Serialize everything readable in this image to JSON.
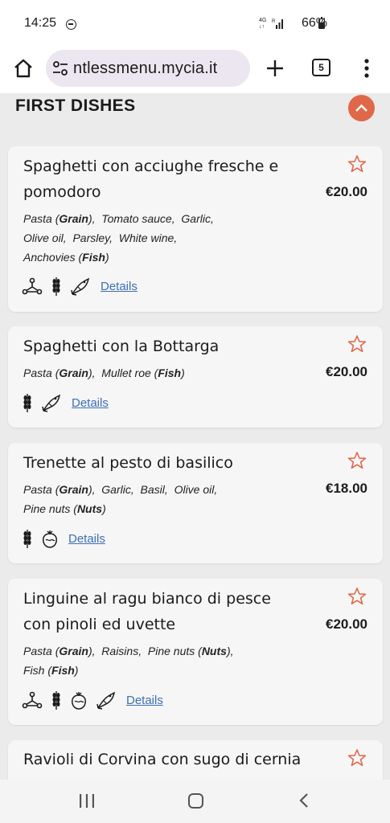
{
  "status_bar": {
    "time": "14:25",
    "network": "4G",
    "battery": "66%"
  },
  "browser": {
    "url": "ntlessmenu.mycia.it",
    "tab_count": "5"
  },
  "section": {
    "title": "FIRST DISHES"
  },
  "dishes": [
    {
      "name": "Spaghetti con acciughe fresche e pomodoro",
      "price": "€20.00",
      "ingredients": [
        {
          "name": "Pasta",
          "allergen": "Grain"
        },
        {
          "name": "Tomato sauce"
        },
        {
          "name": "Garlic"
        },
        {
          "name": "Olive oil"
        },
        {
          "name": "Parsley"
        },
        {
          "name": "White wine"
        },
        {
          "name": "Anchovies",
          "allergen": "Fish"
        }
      ],
      "icons": [
        "molecule-icon",
        "wheat-icon",
        "fish-icon"
      ],
      "details_label": "Details"
    },
    {
      "name": "Spaghetti con la Bottarga",
      "price": "€20.00",
      "ingredients": [
        {
          "name": "Pasta",
          "allergen": "Grain"
        },
        {
          "name": "Mullet roe",
          "allergen": "Fish"
        }
      ],
      "icons": [
        "wheat-icon",
        "fish-icon"
      ],
      "details_label": "Details"
    },
    {
      "name": "Trenette al pesto di basilico",
      "price": "€18.00",
      "ingredients": [
        {
          "name": "Pasta",
          "allergen": "Grain"
        },
        {
          "name": "Garlic"
        },
        {
          "name": "Basil"
        },
        {
          "name": "Olive oil"
        },
        {
          "name": "Pine nuts",
          "allergen": "Nuts"
        }
      ],
      "icons": [
        "wheat-icon",
        "nut-icon"
      ],
      "details_label": "Details"
    },
    {
      "name": "Linguine al ragu bianco di pesce con pinoli ed uvette",
      "price": "€20.00",
      "ingredients": [
        {
          "name": "Pasta",
          "allergen": "Grain"
        },
        {
          "name": "Raisins"
        },
        {
          "name": "Pine nuts",
          "allergen": "Nuts"
        },
        {
          "name": "Fish",
          "allergen": "Fish"
        }
      ],
      "icons": [
        "molecule-icon",
        "wheat-icon",
        "nut-icon",
        "fish-icon"
      ],
      "details_label": "Details"
    },
    {
      "name": "Ravioli di Corvina con sugo di cernia",
      "price": "",
      "ingredients": [],
      "icons": [],
      "details_label": ""
    }
  ],
  "colors": {
    "accent": "#e0684a",
    "link": "#3d6fb3",
    "card_bg": "#f6f6f6",
    "page_bg": "#ebebeb"
  }
}
